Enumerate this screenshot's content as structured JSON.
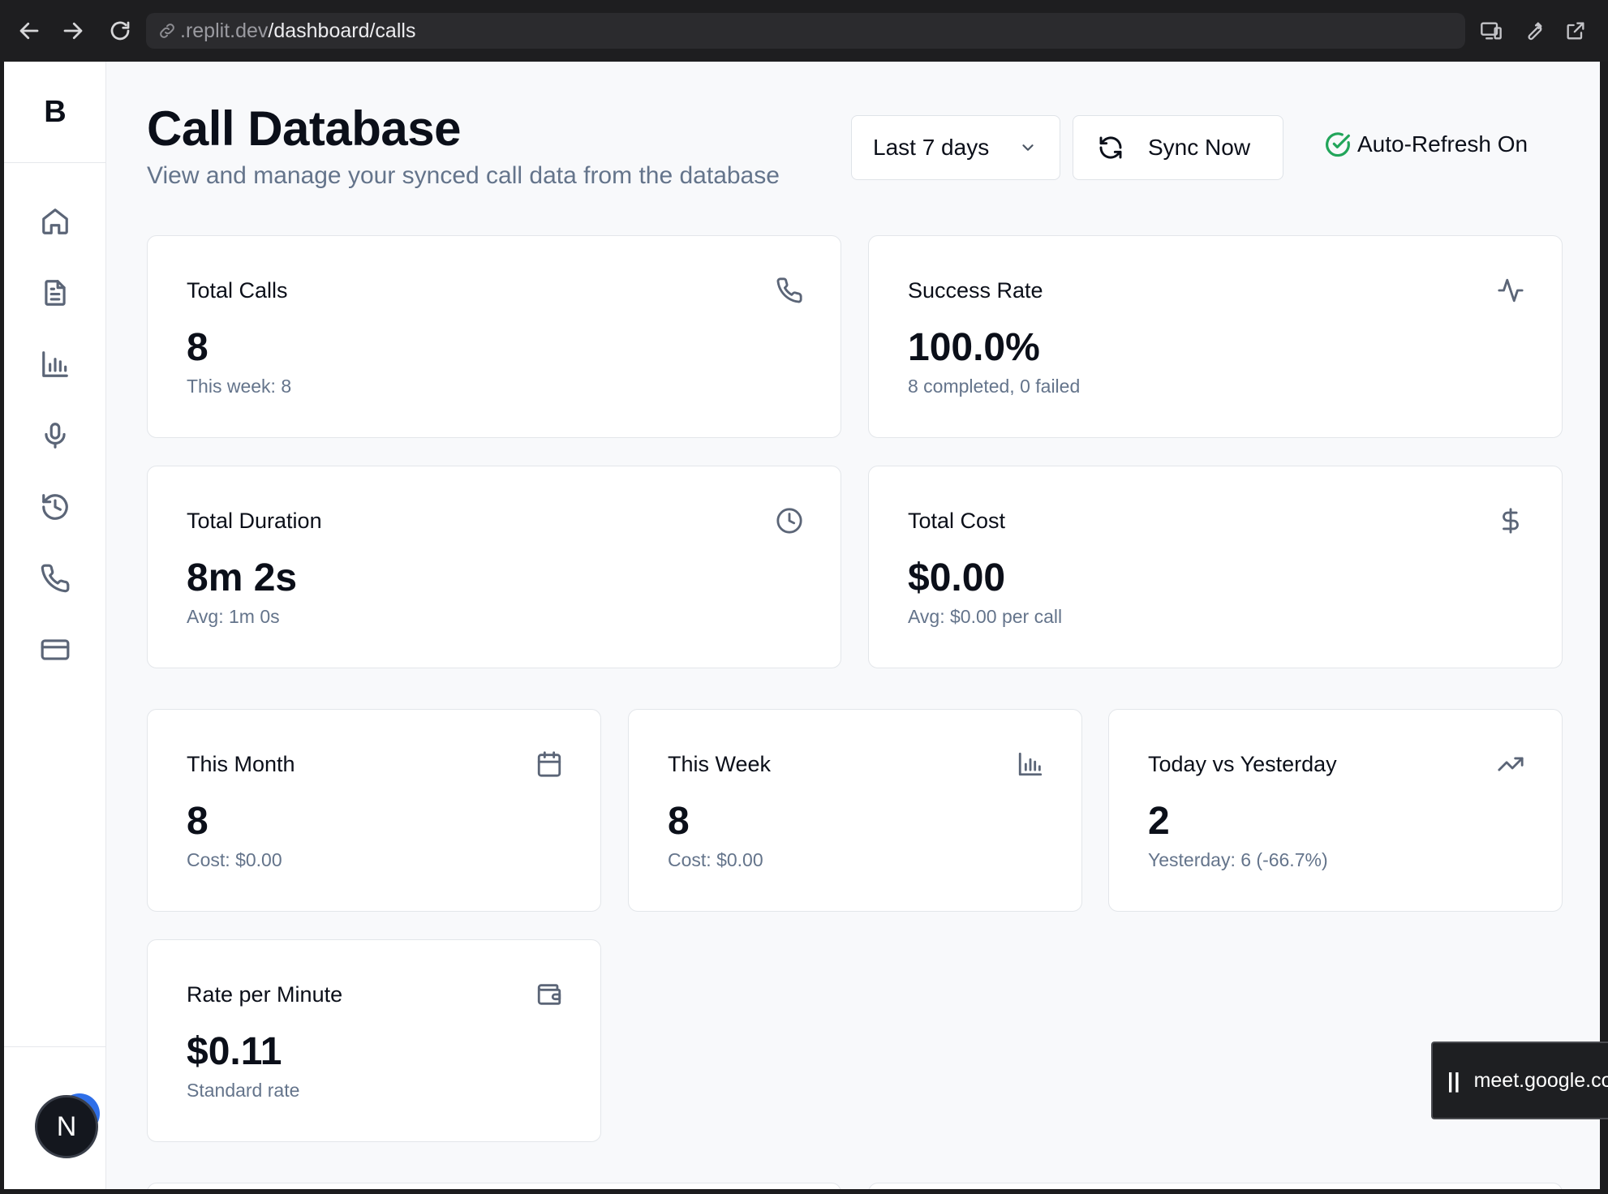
{
  "browser": {
    "url_host": ".replit.dev",
    "url_path": "/dashboard/calls"
  },
  "sidebar": {
    "logo": "B",
    "items": [
      {
        "icon": "home-icon"
      },
      {
        "icon": "document-icon"
      },
      {
        "icon": "bar-chart-icon"
      },
      {
        "icon": "microphone-icon"
      },
      {
        "icon": "history-icon"
      },
      {
        "icon": "phone-icon"
      },
      {
        "icon": "credit-card-icon"
      }
    ],
    "avatar_initial": "N"
  },
  "header": {
    "title": "Call Database",
    "subtitle": "View and manage your synced call data from the database",
    "range_select": "Last 7 days",
    "sync_button": "Sync Now",
    "auto_refresh": "Auto-Refresh On"
  },
  "stats": {
    "total_calls": {
      "title": "Total Calls",
      "value": "8",
      "sub": "This week: 8",
      "icon": "phone-icon"
    },
    "success_rate": {
      "title": "Success Rate",
      "value": "100.0%",
      "sub": "8 completed, 0 failed",
      "icon": "activity-icon"
    },
    "total_duration": {
      "title": "Total Duration",
      "value": "8m 2s",
      "sub": "Avg: 1m 0s",
      "icon": "clock-icon"
    },
    "total_cost": {
      "title": "Total Cost",
      "value": "$0.00",
      "sub": "Avg: $0.00 per call",
      "icon": "dollar-icon"
    },
    "this_month": {
      "title": "This Month",
      "value": "8",
      "sub": "Cost: $0.00",
      "icon": "calendar-icon"
    },
    "this_week": {
      "title": "This Week",
      "value": "8",
      "sub": "Cost: $0.00",
      "icon": "bar-chart-icon"
    },
    "today_vs_yesterday": {
      "title": "Today vs Yesterday",
      "value": "2",
      "sub": "Yesterday: 6 (-66.7%)",
      "icon": "trending-up-icon"
    },
    "rate_per_minute": {
      "title": "Rate per Minute",
      "value": "$0.11",
      "sub": "Standard rate",
      "icon": "wallet-icon"
    }
  },
  "toast": {
    "pause": "||",
    "text": "meet.google.com"
  },
  "colors": {
    "accent_green": "#22a55a",
    "avatar_badge": "#2f6fe8",
    "muted_text": "#64748b"
  }
}
